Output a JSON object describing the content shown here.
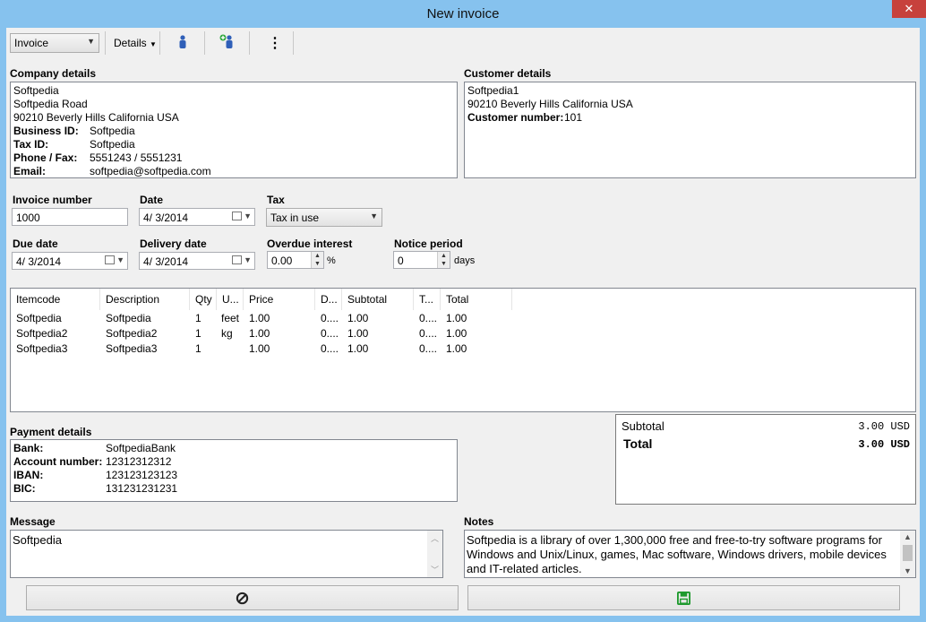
{
  "window": {
    "title": "New invoice",
    "close_icon": "✕"
  },
  "toolbar": {
    "doc_type": "Invoice",
    "details_label": "Details",
    "customer_icon": "person-icon",
    "add_customer_icon": "add-person-icon",
    "more_icon": "⋮"
  },
  "company": {
    "heading": "Company details",
    "name": "Softpedia",
    "street": "Softpedia Road",
    "city": "90210 Beverly Hills California USA",
    "business_id_label": "Business ID:",
    "business_id": "Softpedia",
    "tax_id_label": "Tax ID:",
    "tax_id": "Softpedia",
    "phone_label": "Phone / Fax:",
    "phone": "5551243 / 5551231",
    "email_label": "Email:",
    "email": "softpedia@softpedia.com"
  },
  "customer": {
    "heading": "Customer details",
    "name": "Softpedia1",
    "city": "90210 Beverly Hills California USA",
    "number_label": "Customer number:",
    "number": "101"
  },
  "fields": {
    "invoice_number_label": "Invoice number",
    "invoice_number": "1000",
    "date_label": "Date",
    "date": "4/  3/2014",
    "tax_label": "Tax",
    "tax": "Tax in use",
    "due_date_label": "Due date",
    "due_date": "4/  3/2014",
    "delivery_date_label": "Delivery date",
    "delivery_date": "4/  3/2014",
    "overdue_label": "Overdue interest",
    "overdue": "0.00",
    "overdue_unit": "%",
    "notice_label": "Notice period",
    "notice": "0",
    "notice_unit": "days"
  },
  "items": {
    "headers": [
      "Itemcode",
      "Description",
      "Qty",
      "U...",
      "Price",
      "D...",
      "Subtotal",
      "T...",
      "Total"
    ],
    "rows": [
      [
        "Softpedia",
        "Softpedia",
        "1",
        "feet",
        "1.00",
        "0....",
        "1.00",
        "0....",
        "1.00"
      ],
      [
        "Softpedia2",
        "Softpedia2",
        "1",
        "kg",
        "1.00",
        "0....",
        "1.00",
        "0....",
        "1.00"
      ],
      [
        "Softpedia3",
        "Softpedia3",
        "1",
        "",
        "1.00",
        "0....",
        "1.00",
        "0....",
        "1.00"
      ]
    ]
  },
  "payment": {
    "heading": "Payment details",
    "bank_label": "Bank:",
    "bank": "SoftpediaBank",
    "account_label": "Account number:",
    "account": "12312312312",
    "iban_label": "IBAN:",
    "iban": "123123123123",
    "bic_label": "BIC:",
    "bic": "131231231231"
  },
  "totals": {
    "subtotal_label": "Subtotal",
    "subtotal": "3.00 USD",
    "total_label": "Total",
    "total": "3.00 USD"
  },
  "message": {
    "heading": "Message",
    "text": "Softpedia"
  },
  "notes": {
    "heading": "Notes",
    "text": "Softpedia is a library of over 1,300,000 free and free-to-try software programs for Windows and Unix/Linux, games, Mac software, Windows drivers, mobile devices and IT-related articles."
  },
  "buttons": {
    "cancel_icon": "cancel-icon",
    "save_icon": "save-icon"
  },
  "colors": {
    "title_bar": "#86c2ee",
    "close": "#c7413c",
    "save_green": "#1f9a2e"
  }
}
